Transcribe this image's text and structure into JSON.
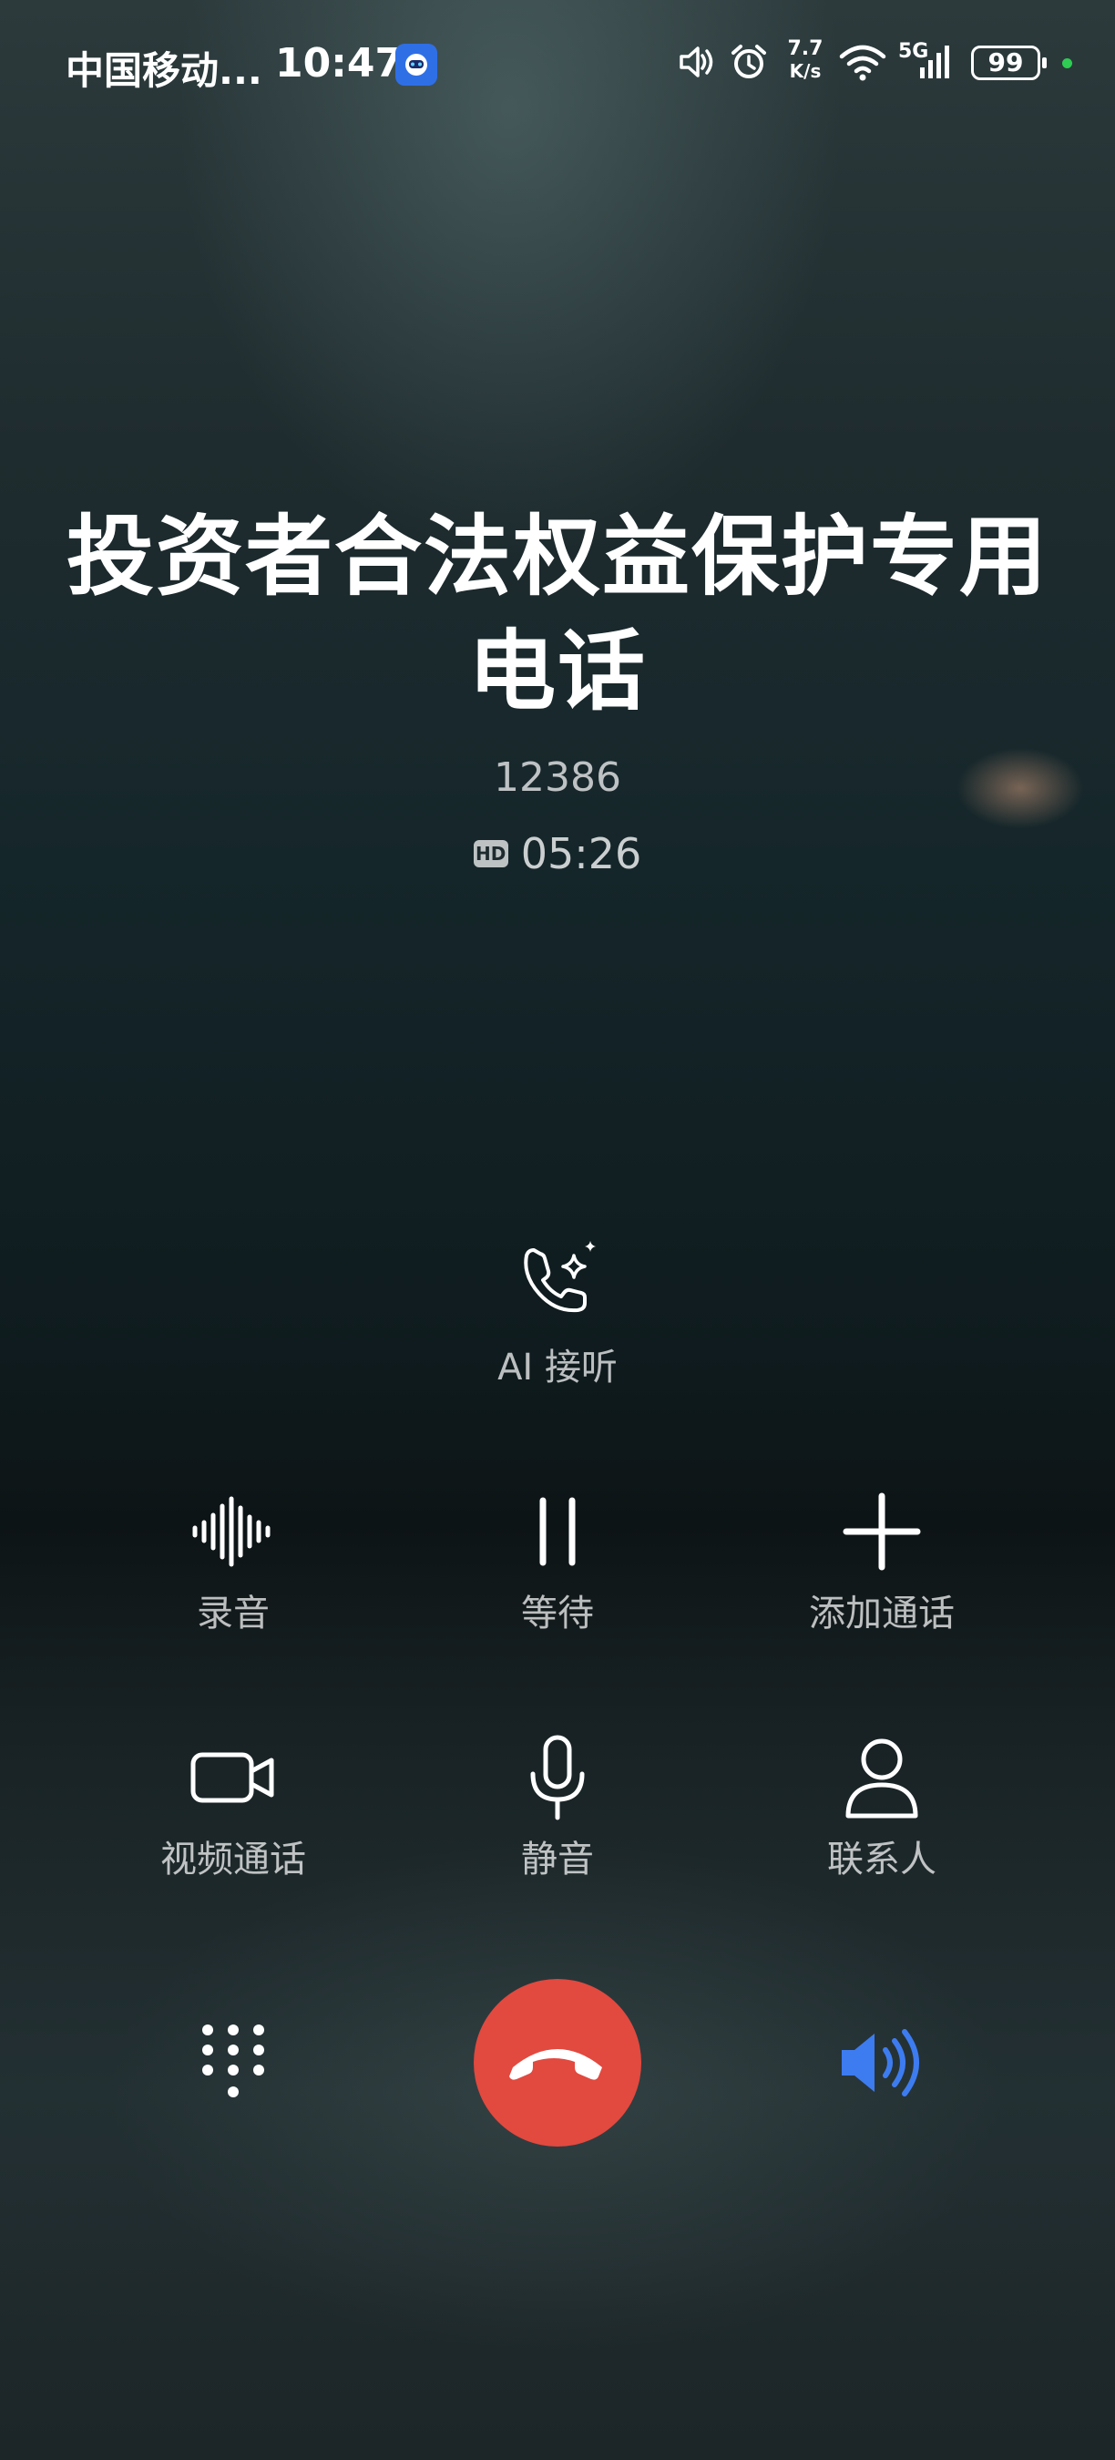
{
  "status_bar": {
    "carrier": "中国移动...",
    "time": "10:47",
    "net_speed": "7.7",
    "net_speed_unit": "K/s",
    "network_type": "5G",
    "battery": "99"
  },
  "call": {
    "caller_name": "投资者合法权益保护专用电话",
    "number": "12386",
    "hd_label": "HD",
    "duration": "05:26"
  },
  "ai_answer": {
    "label": "AI 接听"
  },
  "controls": {
    "record": "录音",
    "hold": "等待",
    "add_call": "添加通话",
    "video_call": "视频通话",
    "mute": "静音",
    "contacts": "联系人"
  },
  "colors": {
    "end_call": "#e2493f",
    "speaker_active": "#3d7cf0",
    "battery_dot": "#2ecc52"
  }
}
